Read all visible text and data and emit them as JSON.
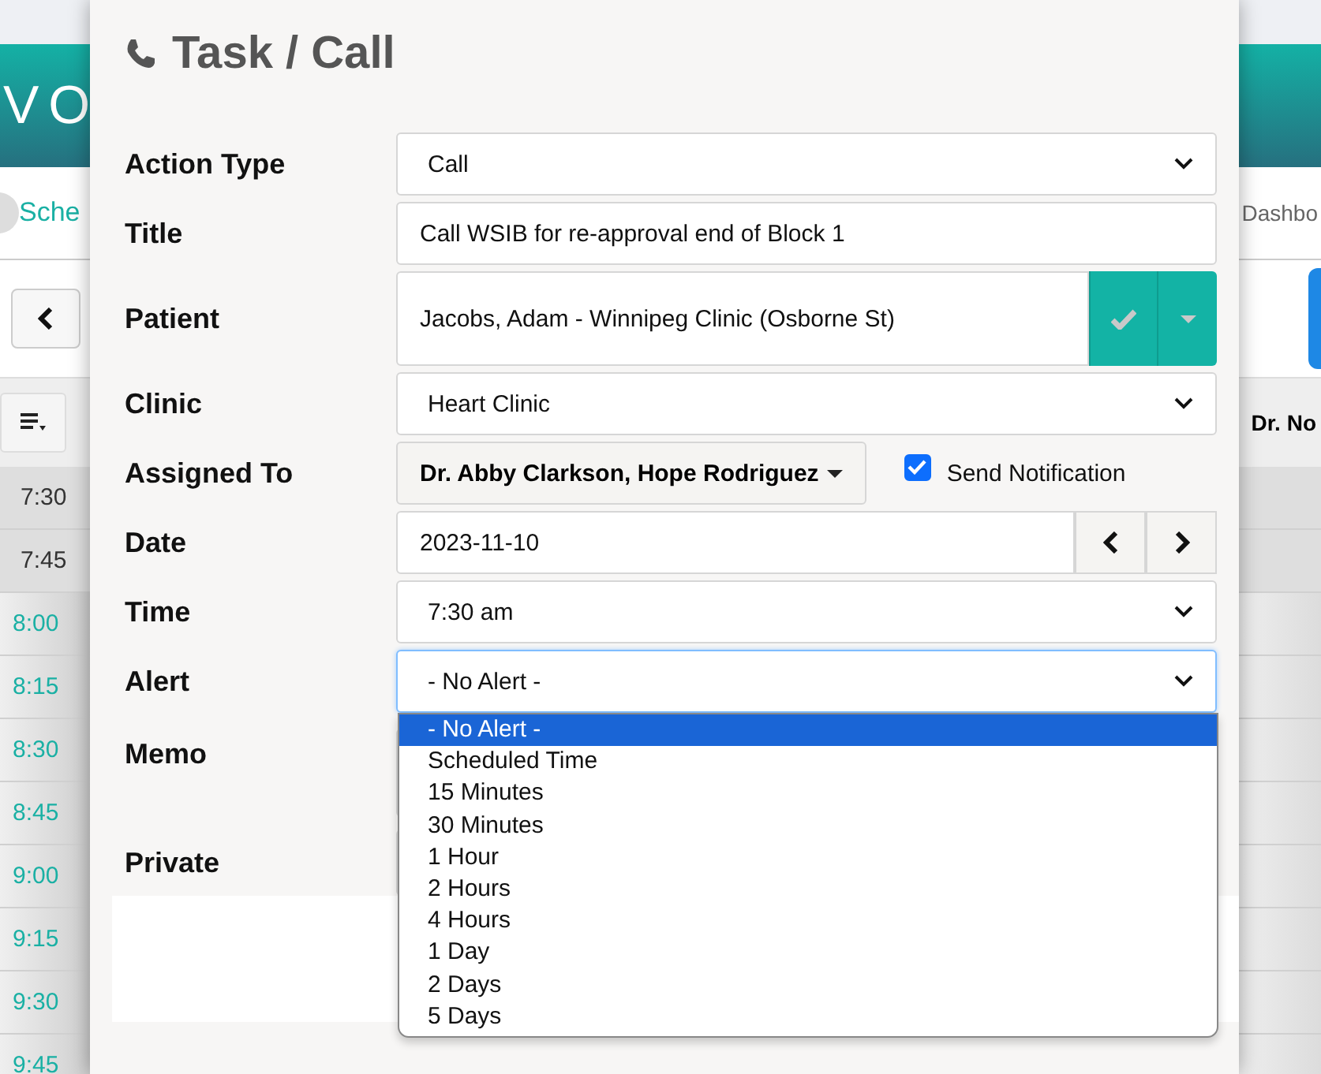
{
  "background": {
    "brand": "VO",
    "left_link": "Sche",
    "right_link": "Dashbo",
    "right_header": "Dr. No",
    "times": [
      {
        "label": "7:30",
        "kind": "past"
      },
      {
        "label": "7:45",
        "kind": "past"
      },
      {
        "label": "8:00",
        "kind": "open"
      },
      {
        "label": "8:15",
        "kind": "open"
      },
      {
        "label": "8:30",
        "kind": "open"
      },
      {
        "label": "8:45",
        "kind": "open"
      },
      {
        "label": "9:00",
        "kind": "open"
      },
      {
        "label": "9:15",
        "kind": "open"
      },
      {
        "label": "9:30",
        "kind": "open"
      },
      {
        "label": "9:45",
        "kind": "open"
      }
    ]
  },
  "dialog": {
    "title": "Task / Call",
    "fields": [
      {
        "kind": "select",
        "label": "Action Type",
        "value": "Call"
      },
      {
        "kind": "text",
        "label": "Title",
        "value": "Call WSIB for re-approval end of Block 1"
      },
      {
        "kind": "patient",
        "label": "Patient",
        "value": "Jacobs, Adam - Winnipeg Clinic (Osborne St)"
      },
      {
        "kind": "select",
        "label": "Clinic",
        "value": "Heart Clinic"
      },
      {
        "kind": "assignee",
        "label": "Assigned To",
        "value": "Dr. Abby Clarkson, Hope Rodriguez",
        "notify_label": "Send Notification",
        "notify_checked": true
      },
      {
        "kind": "date",
        "label": "Date",
        "value": "2023-11-10"
      },
      {
        "kind": "select",
        "label": "Time",
        "value": "7:30 am"
      },
      {
        "kind": "select",
        "label": "Alert",
        "value": "- No Alert -",
        "focused": true,
        "expanded": true,
        "options": [
          {
            "label": "- No Alert -",
            "selected": true
          },
          {
            "label": "Scheduled Time",
            "selected": false
          },
          {
            "label": "15 Minutes",
            "selected": false
          },
          {
            "label": "30 Minutes",
            "selected": false
          },
          {
            "label": "1 Hour",
            "selected": false
          },
          {
            "label": "2 Hours",
            "selected": false
          },
          {
            "label": "4 Hours",
            "selected": false
          },
          {
            "label": "1 Day",
            "selected": false
          },
          {
            "label": "2 Days",
            "selected": false
          },
          {
            "label": "5 Days",
            "selected": false
          }
        ]
      },
      {
        "kind": "memo",
        "label": "Memo"
      },
      {
        "kind": "private",
        "label": "Private"
      }
    ]
  }
}
